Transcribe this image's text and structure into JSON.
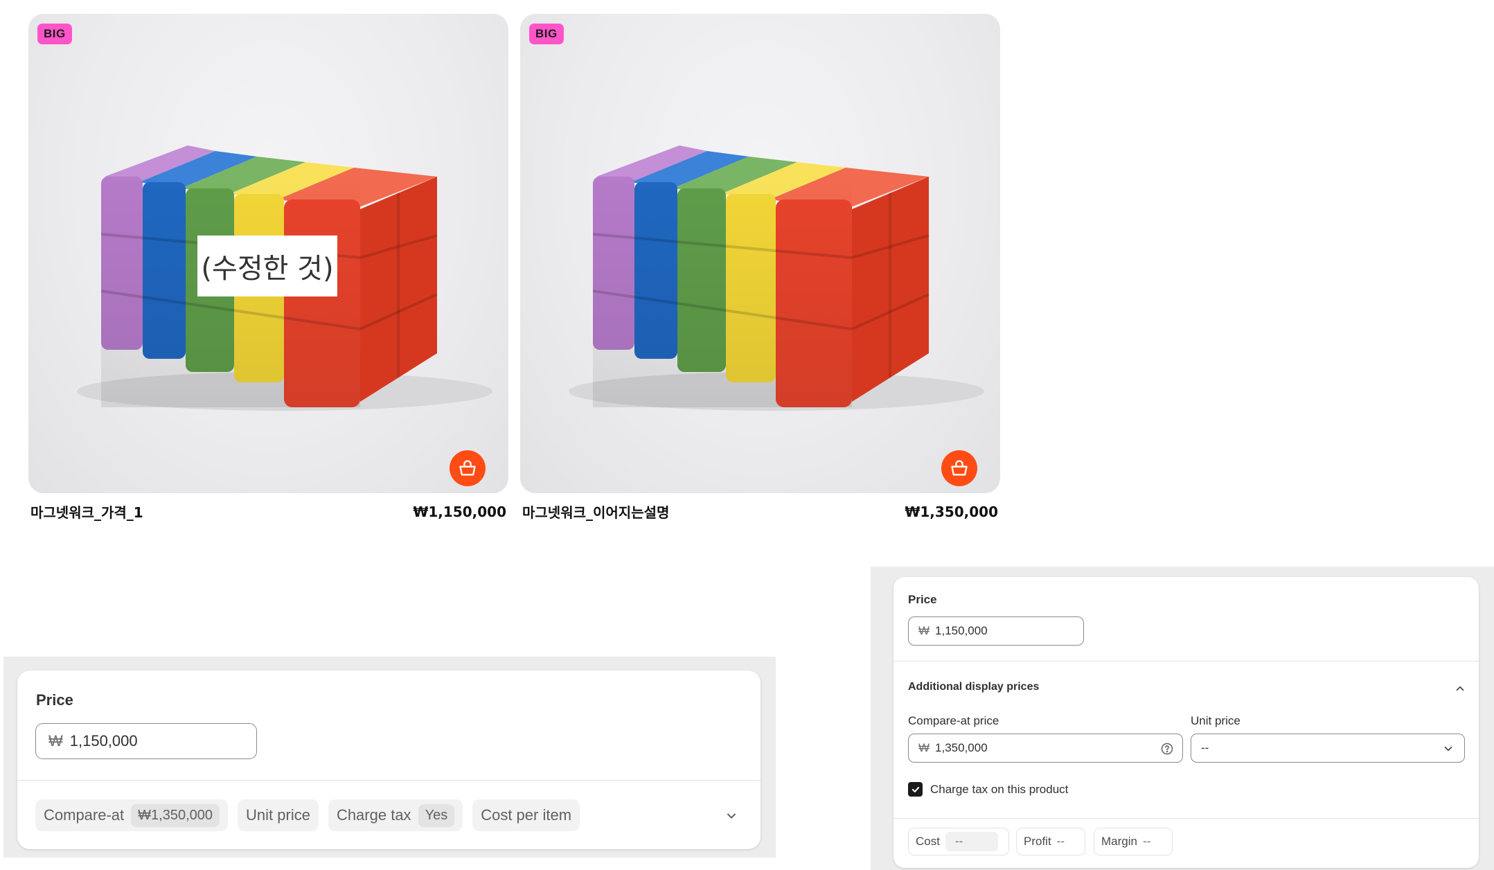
{
  "products": [
    {
      "badge": "BIG",
      "name": "마그넷워크_가격_1",
      "price": "₩1,150,000",
      "overlay": "(수정한 것)"
    },
    {
      "badge": "BIG",
      "name": "마그넷워크_이어지는설명",
      "price": "₩1,350,000"
    }
  ],
  "colors": {
    "badge": "#ff55c8",
    "cart_button": "#ff4c14",
    "cube_purple": "#b57ac9",
    "cube_blue": "#1f67c0",
    "cube_green": "#5f9d4a",
    "cube_yellow": "#f3d637",
    "cube_red": "#e8432b"
  },
  "icons": {
    "cart": "shopping-basket-icon",
    "chevron": "chevron-down-icon",
    "help": "question-circle-icon"
  },
  "panel_compact": {
    "price_label": "Price",
    "currency": "₩",
    "price_value": "1,150,000",
    "pills": [
      {
        "label": "Compare-at",
        "tag": "₩1,350,000"
      },
      {
        "label": "Unit price"
      },
      {
        "label": "Charge tax",
        "tag": "Yes"
      },
      {
        "label": "Cost per item"
      }
    ]
  },
  "panel_expanded": {
    "price_label": "Price",
    "currency": "₩",
    "price_value": "1,150,000",
    "section_title": "Additional display prices",
    "compare_at_label": "Compare-at price",
    "compare_at_value": "1,350,000",
    "unit_price_label": "Unit price",
    "unit_price_value": "--",
    "charge_tax_label": "Charge tax on this product",
    "charge_tax_checked": true,
    "cost_label": "Cost",
    "cost_value": "--",
    "profit_label": "Profit",
    "profit_value": "--",
    "margin_label": "Margin",
    "margin_value": "--"
  }
}
